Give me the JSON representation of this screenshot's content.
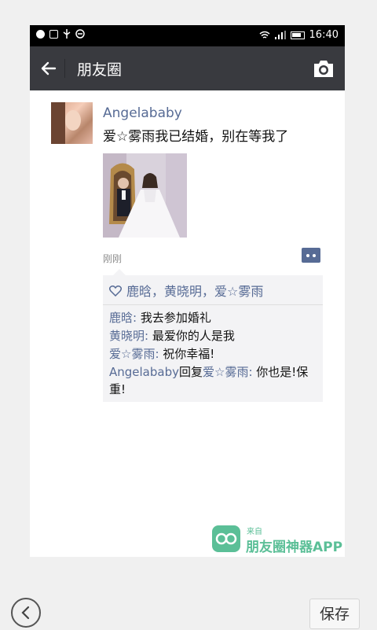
{
  "status_bar": {
    "time": "16:40",
    "left_icons": [
      "wechat-icon",
      "apps-icon",
      "usb-icon",
      "dnd-icon"
    ],
    "right_icons": [
      "wifi-icon",
      "signal-icon",
      "battery-icon"
    ]
  },
  "nav": {
    "back_icon": "arrow-left-icon",
    "title": "朋友圈",
    "camera_icon": "camera-icon"
  },
  "post": {
    "username": "Angelababy",
    "text": "爱☆雾雨我已结婚，别在等我了",
    "timestamp": "刚刚",
    "likes": "鹿晗，黄晓明，爱☆雾雨",
    "comments": [
      {
        "name": "鹿晗",
        "sep": ": ",
        "text": "我去参加婚礼"
      },
      {
        "name": "黄晓明",
        "sep": ": ",
        "text": "最爱你的人是我"
      },
      {
        "name": "爱☆雾雨",
        "sep": ": ",
        "text": "祝你幸福!"
      }
    ],
    "reply": {
      "from": "Angelababy",
      "verb": "回复",
      "to": "爱☆雾雨",
      "sep": ": ",
      "text": "你也是!保重!"
    }
  },
  "watermark": {
    "small": "来自",
    "big": "朋友圈神器APP"
  },
  "bottom": {
    "save_label": "保存"
  },
  "colors": {
    "link": "#576b95",
    "navbar": "#393a3f",
    "watermark": "#5bbf97"
  }
}
